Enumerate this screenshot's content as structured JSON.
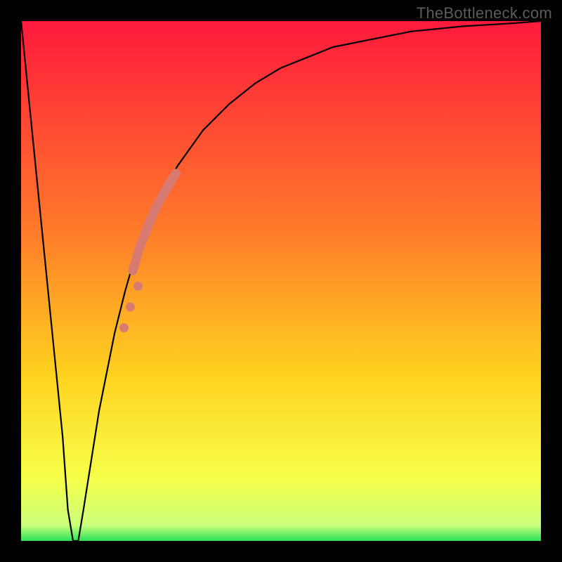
{
  "watermark": "TheBottleneck.com",
  "chart_data": {
    "type": "line",
    "title": "",
    "xlabel": "",
    "ylabel": "",
    "xlim": [
      0,
      100
    ],
    "ylim": [
      0,
      100
    ],
    "grid": false,
    "legend": false,
    "gradient_colors": [
      "#ff1a3c",
      "#ff7a2a",
      "#ffd21f",
      "#f6ff4a",
      "#28e058"
    ],
    "series": [
      {
        "name": "bottleneck-curve",
        "x": [
          0,
          2,
          4,
          6,
          8,
          9,
          10,
          11,
          12,
          15,
          18,
          20,
          22,
          25,
          28,
          30,
          35,
          40,
          45,
          50,
          55,
          60,
          65,
          70,
          75,
          80,
          85,
          90,
          95,
          100
        ],
        "values": [
          100,
          80,
          60,
          40,
          20,
          6,
          0,
          0,
          6,
          25,
          40,
          48,
          55,
          62,
          68,
          72,
          79,
          84,
          88,
          91,
          93,
          95,
          96,
          97,
          98,
          98.5,
          99,
          99.3,
          99.6,
          100
        ],
        "color": "#000000"
      }
    ],
    "highlight_points": {
      "name": "thick-segment",
      "color": "#d77b72",
      "x": [
        21.5,
        22.1,
        22.6,
        23.2,
        23.8,
        24.4,
        25.0,
        25.6,
        26.2,
        26.8,
        27.4,
        28.0,
        28.6,
        29.2,
        29.8,
        22.5,
        21.0,
        19.8
      ],
      "y": [
        52.0,
        54.0,
        55.8,
        57.5,
        59.0,
        60.5,
        62.0,
        63.3,
        64.5,
        65.7,
        66.8,
        67.8,
        68.8,
        69.8,
        70.7,
        49.0,
        45.0,
        41.0
      ]
    }
  }
}
